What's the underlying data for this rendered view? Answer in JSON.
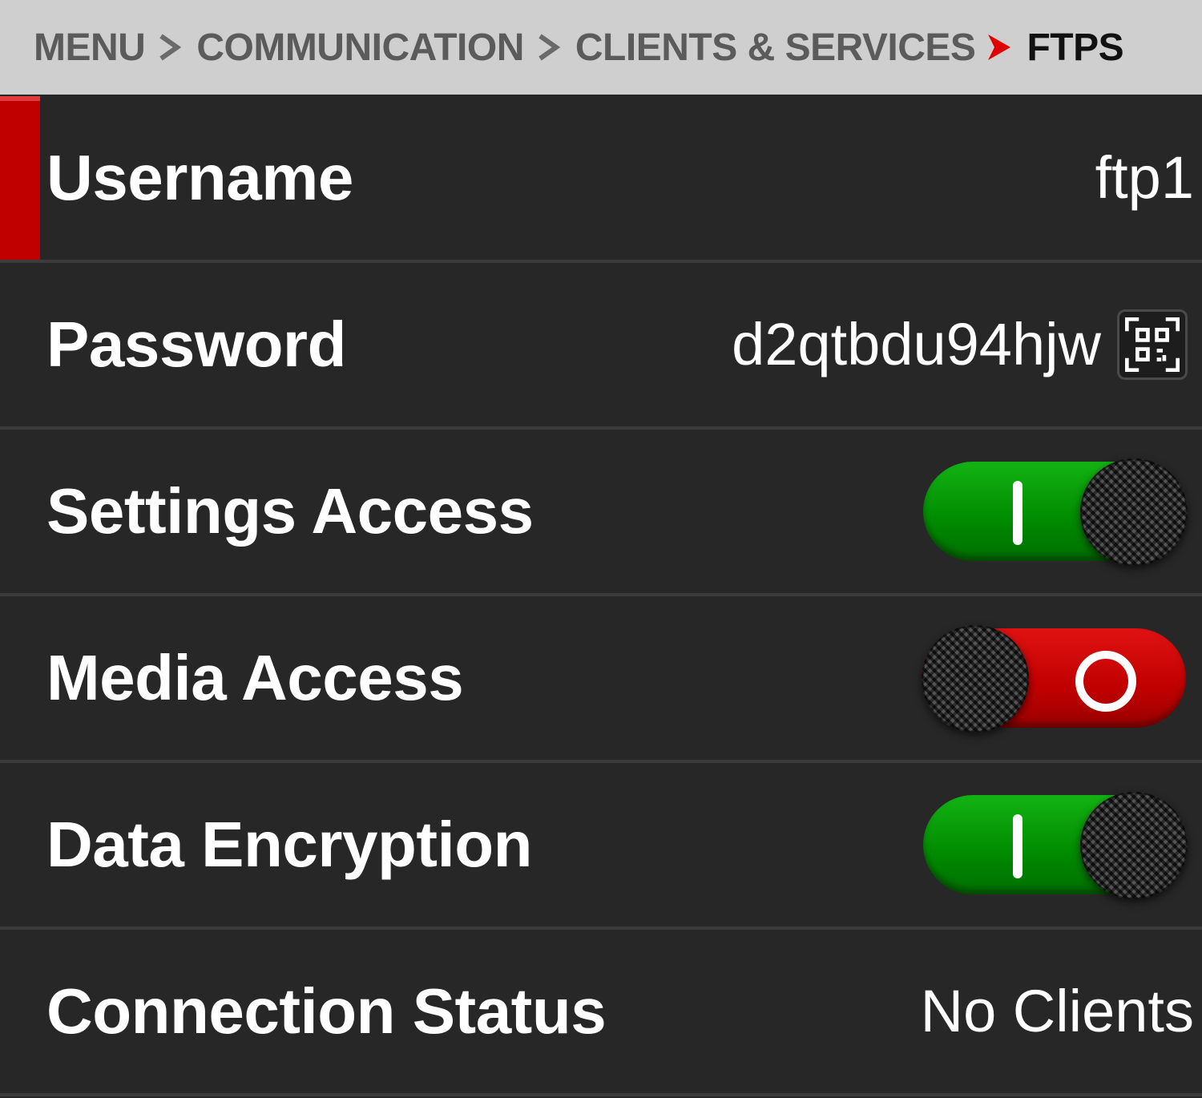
{
  "breadcrumb": {
    "items": [
      "MENU",
      "COMMUNICATION",
      "CLIENTS & SERVICES"
    ],
    "current": "FTPS"
  },
  "colors": {
    "background": "#262626",
    "breadcrumb_bg": "#cfcfcf",
    "accent_red": "#c00000",
    "toggle_on": "#008a00",
    "toggle_off": "#c00000"
  },
  "settings": {
    "username": {
      "label": "Username",
      "value": "ftp1",
      "selected": true
    },
    "password": {
      "label": "Password",
      "value": "d2qtbdu94hjw",
      "icon": "qr-code-icon"
    },
    "settings_access": {
      "label": "Settings Access",
      "enabled": true
    },
    "media_access": {
      "label": "Media Access",
      "enabled": false
    },
    "data_encryption": {
      "label": "Data Encryption",
      "enabled": true
    },
    "connection_status": {
      "label": "Connection Status",
      "value": "No Clients"
    }
  }
}
